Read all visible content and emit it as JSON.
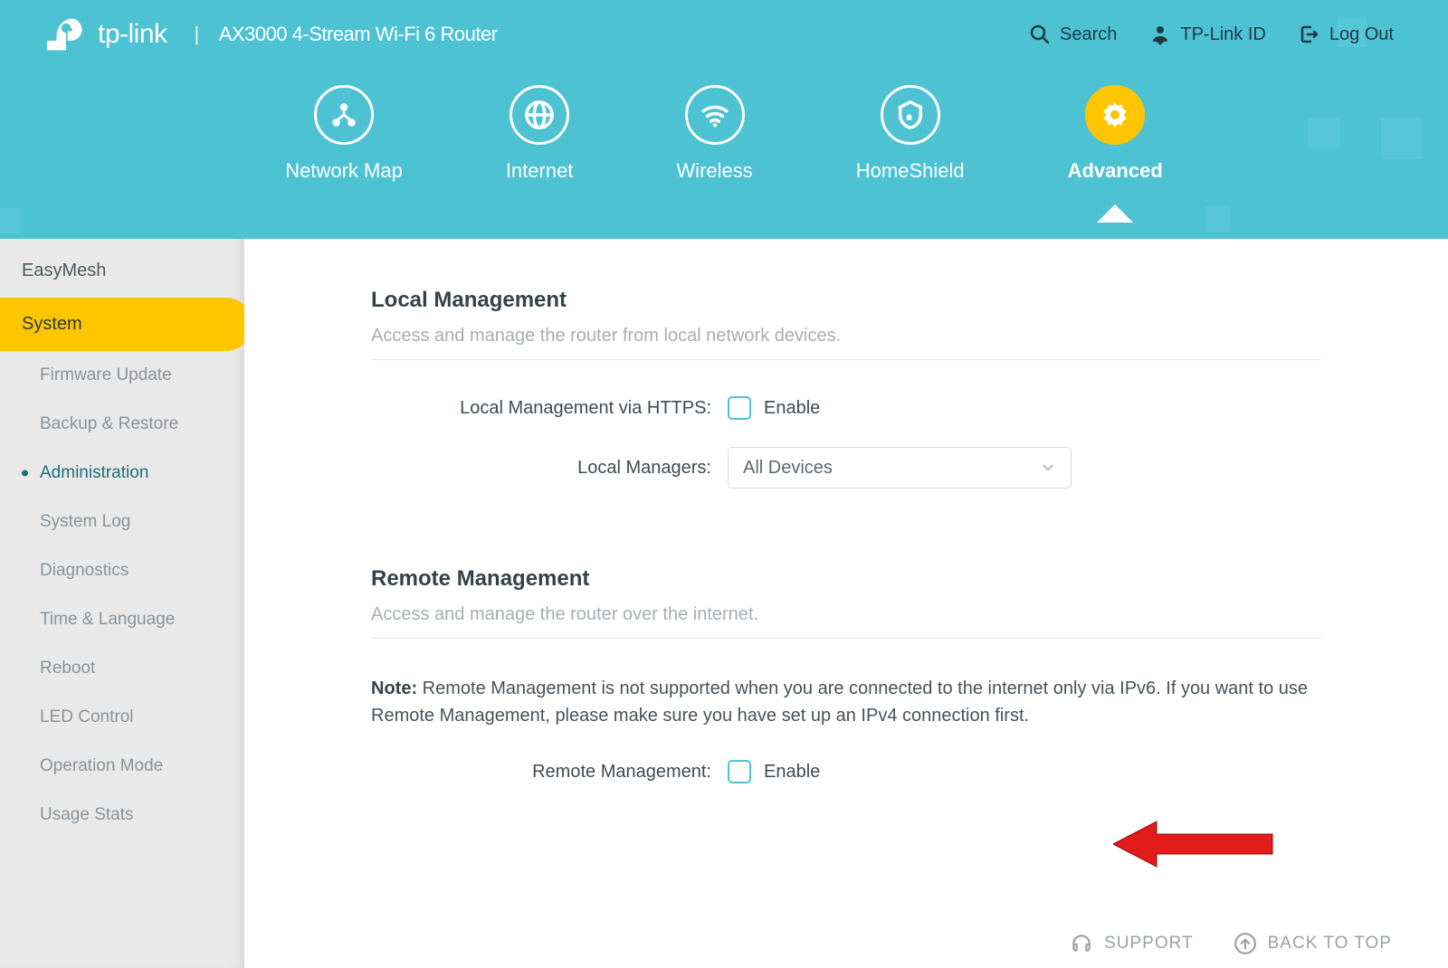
{
  "header": {
    "brand": "tp-link",
    "model": "AX3000 4-Stream Wi-Fi 6 Router",
    "actions": {
      "search": "Search",
      "tplinkid": "TP-Link ID",
      "logout": "Log Out"
    }
  },
  "nav": {
    "items": [
      {
        "label": "Network Map",
        "active": false
      },
      {
        "label": "Internet",
        "active": false
      },
      {
        "label": "Wireless",
        "active": false
      },
      {
        "label": "HomeShield",
        "active": false
      },
      {
        "label": "Advanced",
        "active": true
      }
    ]
  },
  "sidebar": {
    "top": [
      {
        "label": "EasyMesh",
        "selected": false
      },
      {
        "label": "System",
        "selected": true
      }
    ],
    "subs": [
      {
        "label": "Firmware Update",
        "active": false
      },
      {
        "label": "Backup & Restore",
        "active": false
      },
      {
        "label": "Administration",
        "active": true
      },
      {
        "label": "System Log",
        "active": false
      },
      {
        "label": "Diagnostics",
        "active": false
      },
      {
        "label": "Time & Language",
        "active": false
      },
      {
        "label": "Reboot",
        "active": false
      },
      {
        "label": "LED Control",
        "active": false
      },
      {
        "label": "Operation Mode",
        "active": false
      },
      {
        "label": "Usage Stats",
        "active": false
      }
    ]
  },
  "sections": {
    "local": {
      "title": "Local Management",
      "desc": "Access and manage the router from local network devices.",
      "https_label": "Local Management via HTTPS:",
      "https_enable": "Enable",
      "managers_label": "Local Managers:",
      "managers_value": "All Devices"
    },
    "remote": {
      "title": "Remote Management",
      "desc": "Access and manage the router over the internet.",
      "note_label": "Note:",
      "note_text": " Remote Management is not supported when you are connected to the internet only via IPv6. If you want to use Remote Management, please make sure you have set up an IPv4 connection first.",
      "rm_label": "Remote Management:",
      "rm_enable": "Enable"
    }
  },
  "footer": {
    "support": "SUPPORT",
    "backtotop": "BACK TO TOP"
  }
}
